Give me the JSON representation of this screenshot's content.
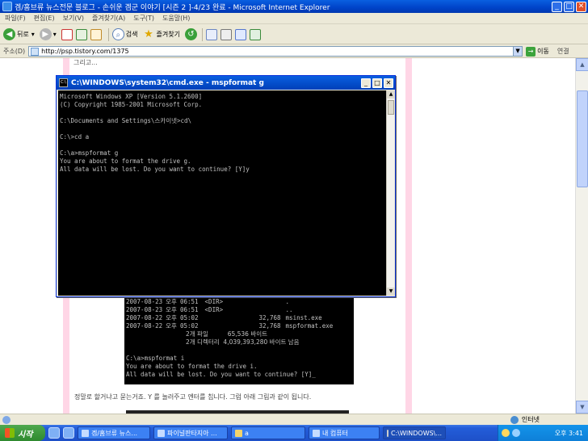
{
  "ie": {
    "title": "겜/홈브류 뉴스전문 블로그 - 손쉬운 겜군 이야기 [시즌 2 ]-4/23 완료 - Microsoft Internet Explorer",
    "menu": [
      "파일(F)",
      "편집(E)",
      "보기(V)",
      "즐겨찾기(A)",
      "도구(T)",
      "도움말(H)"
    ],
    "toolbar": {
      "back": "뒤로",
      "search": "검색",
      "favorites": "즐겨찾기"
    },
    "address_label": "주소(D)",
    "url": "http://psp.tistory.com/1375",
    "go_label": "이동",
    "links_label": "연결"
  },
  "page": {
    "intro": "그리고...",
    "inline_cmd": {
      "rows": [
        {
          "date": "2007-08-23",
          "ampm": "오후",
          "time": "06:51",
          "type": "<DIR>",
          "size": "",
          "name": "."
        },
        {
          "date": "2007-08-23",
          "ampm": "오후",
          "time": "06:51",
          "type": "<DIR>",
          "size": "",
          "name": ".."
        },
        {
          "date": "2007-08-22",
          "ampm": "오후",
          "time": "05:02",
          "type": "",
          "size": "32,768",
          "name": "msinst.exe"
        },
        {
          "date": "2007-08-22",
          "ampm": "오후",
          "time": "05:02",
          "type": "",
          "size": "32,768",
          "name": "mspformat.exe"
        }
      ],
      "summary1": "2개 파일          65,536 바이트",
      "summary2": "2개 디렉터리  4,039,393,280 바이트 남음",
      "cmd": "C:\\a>mspformat i",
      "line1": "You are about to format the drive i.",
      "line2": "All data will be lost. Do you want to continue? [Y]"
    },
    "caption": "정말로 할거냐고 묻는거죠.  Y 를 눌러주고 엔터를 칩니다.  그럼 아래 그림과 같이 됩니다."
  },
  "cmd_window": {
    "title": "C:\\WINDOWS\\system32\\cmd.exe - mspformat g",
    "lines": [
      "Microsoft Windows XP [Version 5.1.2600]",
      "(C) Copyright 1985-2001 Microsoft Corp.",
      "",
      "C:\\Documents and Settings\\스카이넷>cd\\",
      "",
      "C:\\>cd a",
      "",
      "C:\\a>mspformat g",
      "You are about to format the drive g.",
      "All data will be lost. Do you want to continue? [Y]y"
    ]
  },
  "status": {
    "zone": "인터넷"
  },
  "taskbar": {
    "start": "시작",
    "tasks": [
      "겜/홈브류 뉴스...",
      "파이널판타지아 ...",
      "a",
      "내 컴퓨터",
      "C:\\WINDOWS\\..."
    ],
    "clock": "오후 3:41"
  }
}
